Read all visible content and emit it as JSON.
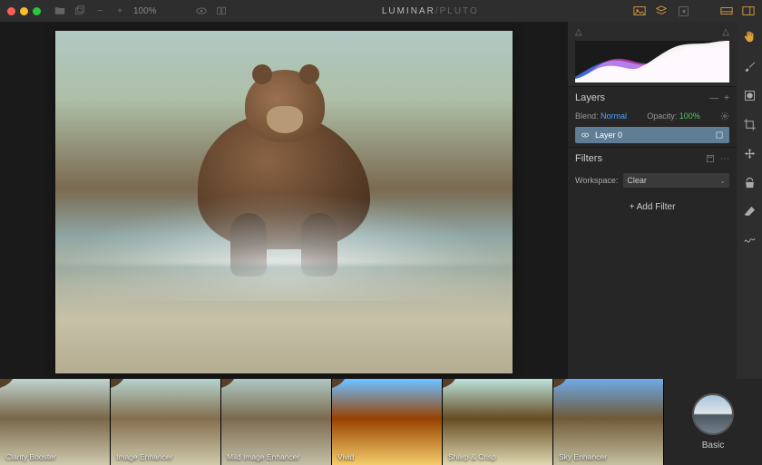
{
  "app": {
    "title_main": "LUMINAR",
    "title_sub": "/PLUTO"
  },
  "topbar": {
    "zoom": "100%"
  },
  "histogram": {
    "tab_left": "△",
    "tab_right": "△"
  },
  "layers_panel": {
    "title": "Layers",
    "blend_label": "Blend:",
    "blend_value": "Normal",
    "opacity_label": "Opacity:",
    "opacity_value": "100%",
    "layer0_name": "Layer 0"
  },
  "filters_panel": {
    "title": "Filters",
    "workspace_label": "Workspace:",
    "workspace_value": "Clear",
    "add_filter_label": "Add Filter"
  },
  "presets": [
    {
      "label": "Clarity Booster"
    },
    {
      "label": "Image Enhancer"
    },
    {
      "label": "Mild Image Enhancer"
    },
    {
      "label": "Vivid"
    },
    {
      "label": "Sharp & Crisp"
    },
    {
      "label": "Sky Enhancer"
    }
  ],
  "preset_category": {
    "label": "Basic"
  }
}
